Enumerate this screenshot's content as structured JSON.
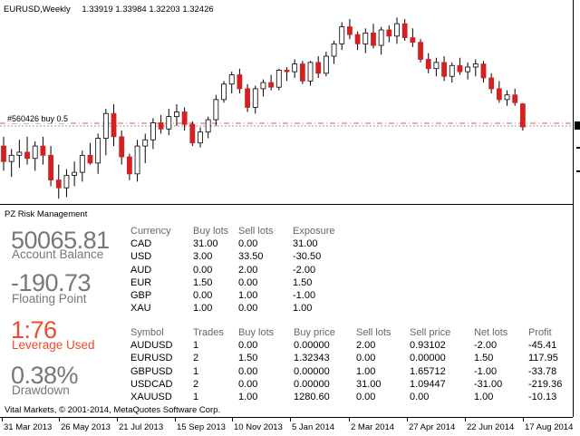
{
  "chart": {
    "symbol_period": "EURUSD,Weekly",
    "ohlc_readout": "1.33919 1.33984 1.32203 1.32426",
    "order_label": "#560426 buy 0.5",
    "colors": {
      "bull": "#ffffff",
      "bear": "#d42020",
      "outline": "#000000",
      "order_line": "#c86464"
    },
    "time_labels": [
      "31 Mar 2013",
      "26 May 2013",
      "21 Jul 2013",
      "15 Sep 2013",
      "10 Nov 2013",
      "5 Jan 2014",
      "2 Mar 2014",
      "27 Apr 2014",
      "22 Jun 2014",
      "17 Aug 2014"
    ],
    "candles": [
      [
        1.312,
        1.318,
        1.296,
        1.302
      ],
      [
        1.302,
        1.31,
        1.292,
        1.306
      ],
      [
        1.306,
        1.316,
        1.298,
        1.308
      ],
      [
        1.308,
        1.318,
        1.3,
        1.304
      ],
      [
        1.304,
        1.315,
        1.296,
        1.312
      ],
      [
        1.312,
        1.318,
        1.3,
        1.306
      ],
      [
        1.306,
        1.312,
        1.286,
        1.29
      ],
      [
        1.29,
        1.3,
        1.278,
        1.285
      ],
      [
        1.285,
        1.297,
        1.279,
        1.293
      ],
      [
        1.293,
        1.302,
        1.286,
        1.295
      ],
      [
        1.295,
        1.309,
        1.289,
        1.306
      ],
      [
        1.306,
        1.314,
        1.3,
        1.301
      ],
      [
        1.301,
        1.32,
        1.294,
        1.317
      ],
      [
        1.317,
        1.336,
        1.306,
        1.333
      ],
      [
        1.333,
        1.339,
        1.312,
        1.318
      ],
      [
        1.318,
        1.322,
        1.3,
        1.305
      ],
      [
        1.305,
        1.307,
        1.29,
        1.294
      ],
      [
        1.294,
        1.316,
        1.289,
        1.312
      ],
      [
        1.312,
        1.32,
        1.301,
        1.316
      ],
      [
        1.316,
        1.33,
        1.31,
        1.327
      ],
      [
        1.327,
        1.332,
        1.32,
        1.323
      ],
      [
        1.323,
        1.336,
        1.319,
        1.331
      ],
      [
        1.331,
        1.339,
        1.325,
        1.334
      ],
      [
        1.334,
        1.337,
        1.322,
        1.326
      ],
      [
        1.326,
        1.328,
        1.312,
        1.314
      ],
      [
        1.314,
        1.324,
        1.311,
        1.321
      ],
      [
        1.321,
        1.331,
        1.317,
        1.329
      ],
      [
        1.329,
        1.345,
        1.325,
        1.342
      ],
      [
        1.342,
        1.354,
        1.34,
        1.352
      ],
      [
        1.352,
        1.36,
        1.346,
        1.358
      ],
      [
        1.358,
        1.362,
        1.346,
        1.349
      ],
      [
        1.349,
        1.352,
        1.334,
        1.337
      ],
      [
        1.337,
        1.351,
        1.333,
        1.349
      ],
      [
        1.349,
        1.355,
        1.344,
        1.353
      ],
      [
        1.353,
        1.358,
        1.348,
        1.35
      ],
      [
        1.35,
        1.362,
        1.348,
        1.361
      ],
      [
        1.361,
        1.363,
        1.354,
        1.36
      ],
      [
        1.36,
        1.368,
        1.356,
        1.365
      ],
      [
        1.365,
        1.367,
        1.352,
        1.354
      ],
      [
        1.354,
        1.367,
        1.351,
        1.366
      ],
      [
        1.366,
        1.37,
        1.356,
        1.359
      ],
      [
        1.359,
        1.373,
        1.357,
        1.37
      ],
      [
        1.37,
        1.38,
        1.365,
        1.378
      ],
      [
        1.378,
        1.392,
        1.374,
        1.389
      ],
      [
        1.389,
        1.394,
        1.381,
        1.384
      ],
      [
        1.384,
        1.386,
        1.374,
        1.378
      ],
      [
        1.378,
        1.388,
        1.372,
        1.385
      ],
      [
        1.385,
        1.391,
        1.375,
        1.377
      ],
      [
        1.377,
        1.389,
        1.371,
        1.387
      ],
      [
        1.387,
        1.39,
        1.379,
        1.383
      ],
      [
        1.383,
        1.395,
        1.378,
        1.391
      ],
      [
        1.391,
        1.394,
        1.38,
        1.382
      ],
      [
        1.382,
        1.388,
        1.376,
        1.379
      ],
      [
        1.379,
        1.381,
        1.366,
        1.368
      ],
      [
        1.368,
        1.372,
        1.359,
        1.362
      ],
      [
        1.362,
        1.369,
        1.357,
        1.366
      ],
      [
        1.366,
        1.37,
        1.354,
        1.357
      ],
      [
        1.357,
        1.366,
        1.353,
        1.364
      ],
      [
        1.364,
        1.369,
        1.358,
        1.36
      ],
      [
        1.36,
        1.366,
        1.355,
        1.363
      ],
      [
        1.363,
        1.368,
        1.357,
        1.365
      ],
      [
        1.365,
        1.367,
        1.353,
        1.356
      ],
      [
        1.356,
        1.359,
        1.346,
        1.349
      ],
      [
        1.349,
        1.354,
        1.34,
        1.342
      ],
      [
        1.342,
        1.348,
        1.338,
        1.345
      ],
      [
        1.345,
        1.349,
        1.338,
        1.34
      ],
      [
        1.3392,
        1.3398,
        1.322,
        1.3243
      ]
    ]
  },
  "panel": {
    "title": "PZ Risk Management",
    "balance_value": "50065.81",
    "balance_label": "Account Balance",
    "floating_value": "-190.73",
    "floating_label": "Floating Point",
    "leverage_value": "1:76",
    "leverage_label": "Leverage Used",
    "drawdown_value": "0.38%",
    "drawdown_label": "Drawdown",
    "currency_headers": [
      "Currency",
      "Buy lots",
      "Sell lots",
      "Exposure"
    ],
    "currency_rows": [
      [
        "CAD",
        "31.00",
        "0.00",
        "31.00"
      ],
      [
        "USD",
        "3.00",
        "33.50",
        "-30.50"
      ],
      [
        "AUD",
        "0.00",
        "2.00",
        "-2.00"
      ],
      [
        "EUR",
        "1.50",
        "0.00",
        "1.50"
      ],
      [
        "GBP",
        "0.00",
        "1.00",
        "-1.00"
      ],
      [
        "XAU",
        "1.00",
        "0.00",
        "1.00"
      ]
    ],
    "symbol_headers": [
      "Symbol",
      "Trades",
      "Buy lots",
      "Buy price",
      "Sell lots",
      "Sell price",
      "Net lots",
      "Profit"
    ],
    "symbol_rows": [
      [
        "AUDUSD",
        "1",
        "0.00",
        "0.00000",
        "2.00",
        "0.93102",
        "-2.00",
        "-45.41"
      ],
      [
        "EURUSD",
        "2",
        "1.50",
        "1.32343",
        "0.00",
        "0.00000",
        "1.50",
        "117.95"
      ],
      [
        "GBPUSD",
        "1",
        "0.00",
        "0.00000",
        "1.00",
        "1.65712",
        "-1.00",
        "-33.78"
      ],
      [
        "USDCAD",
        "2",
        "0.00",
        "0.00000",
        "31.00",
        "1.09447",
        "-31.00",
        "-219.36"
      ],
      [
        "XAUUSD",
        "1",
        "1.00",
        "1280.60",
        "0.00",
        "0.00",
        "1.00",
        "-10.13"
      ]
    ],
    "footer": "Vital Markets, © 2001-2014, MetaQuotes Software Corp.",
    "leverage_color": "#f04a2a"
  }
}
